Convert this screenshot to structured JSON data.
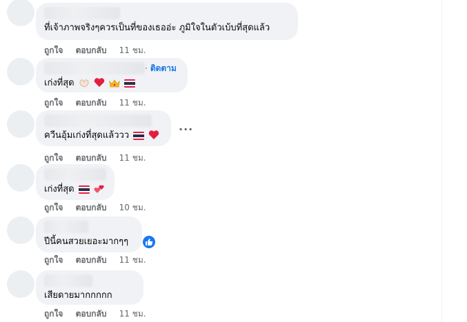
{
  "comments": [
    {
      "text": "ที่เจ้าภาพจริงๆควรเป็นที่ของเธออ่ะ ภูมิใจในตัวเบ้บที่สุดแล้ว",
      "like_label": "ถูกใจ",
      "reply_label": "ตอบกลับ",
      "time": "11 ชม."
    },
    {
      "follow_label": "ติดตาม",
      "text": "เก่งที่สุด",
      "emojis": [
        "heart-hands-icon",
        "red-heart-icon",
        "crown-icon",
        "thailand-flag-icon"
      ],
      "like_label": "ถูกใจ",
      "reply_label": "ตอบกลับ",
      "time": "11 ชม."
    },
    {
      "text": "ควีนอุ้มเก่งที่สุดแล้ววว",
      "emojis": [
        "thailand-flag-icon",
        "red-heart-icon"
      ],
      "more_label": "···",
      "like_label": "ถูกใจ",
      "reply_label": "ตอบกลับ",
      "time": "11 ชม."
    },
    {
      "text": "เก่งที่สุด",
      "emojis": [
        "thailand-flag-icon",
        "two-hearts-icon"
      ],
      "like_label": "ถูกใจ",
      "reply_label": "ตอบกลับ",
      "time": "10 ชม."
    },
    {
      "text": "ปีนี้คนสวยเยอะมากๆๆ",
      "reaction": "like-reaction-icon",
      "like_label": "ถูกใจ",
      "reply_label": "ตอบกลับ",
      "time": "11 ชม."
    },
    {
      "text": "เสียดายมากกกกก",
      "like_label": "ถูกใจ",
      "reply_label": "ตอบกลับ",
      "time": "11 ชม."
    }
  ],
  "colors": {
    "bubble": "#f0f2f5",
    "link_blue": "#1b74e4",
    "meta_gray": "#65676b",
    "heart_red": "#e41e3f"
  }
}
